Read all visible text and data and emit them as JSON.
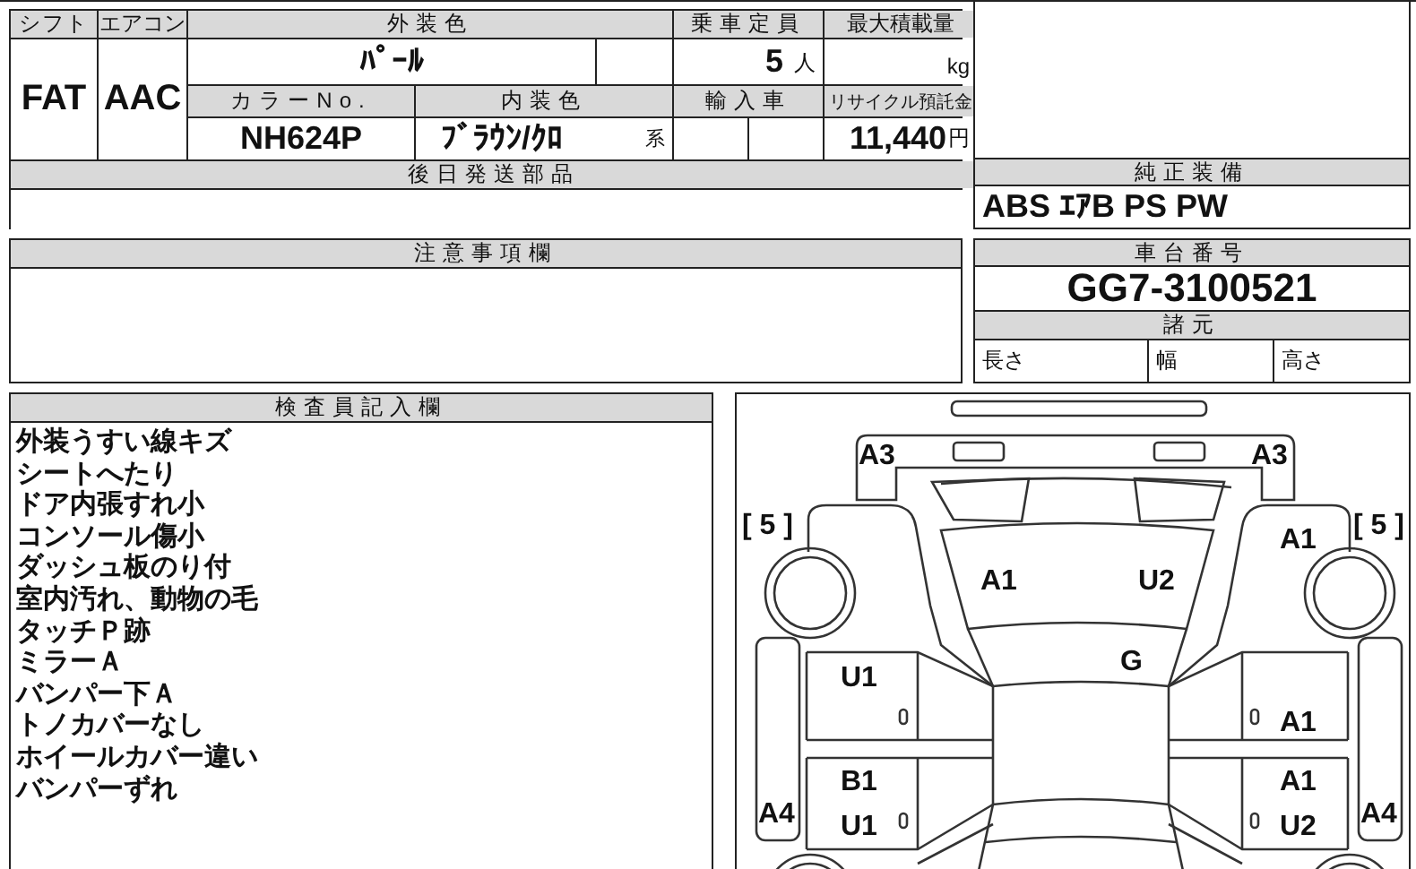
{
  "vehicle_table": {
    "shift": {
      "label": "シフト",
      "value": "FAT"
    },
    "aircon": {
      "label": "エアコン",
      "value": "AAC"
    },
    "exterior_color": {
      "label": "外装色",
      "value": "ﾊﾟｰﾙ"
    },
    "capacity": {
      "label": "乗車定員",
      "value": "5",
      "unit": "人"
    },
    "max_load": {
      "label": "最大積載量",
      "unit": "kg"
    },
    "color_no": {
      "label": "カラーNo.",
      "value": "NH624P"
    },
    "interior_color": {
      "label": "内装色",
      "value": "ﾌﾞﾗｳﾝ/ｸﾛ",
      "suffix": "系"
    },
    "import": {
      "label": "輸入車"
    },
    "recycle_fee": {
      "label": "リサイクル預託金",
      "value": "11,440",
      "unit": "円"
    },
    "parts_later": {
      "label": "後日発送部品"
    }
  },
  "equipment": {
    "label": "純正装備",
    "value": "ABS ｴｱB PS PW"
  },
  "notes": {
    "label": "注意事項欄"
  },
  "chassis": {
    "label": "車台番号",
    "value": "GG7-3100521"
  },
  "specs": {
    "label": "諸元",
    "fields": [
      "長さ",
      "幅",
      "高さ"
    ]
  },
  "inspector": {
    "label": "検査員記入欄",
    "lines": [
      "外装うすい線キズ",
      "シートへたり",
      "ドア内張すれ小",
      "コンソール傷小",
      "ダッシュ板のり付",
      "室内汚れ、動物の毛",
      "タッチＰ跡",
      "ミラーＡ",
      "バンパー下Ａ",
      "トノカバーなし",
      "ホイールカバー違い",
      "バンパーずれ"
    ]
  },
  "diagram": {
    "marks": [
      "A3",
      "A3",
      "[ 5 ]",
      "[ 5 ]",
      "A1",
      "A1",
      "U2",
      "G",
      "U1",
      "A1",
      "B1",
      "A1",
      "A4",
      "U1",
      "U2",
      "A4"
    ]
  }
}
